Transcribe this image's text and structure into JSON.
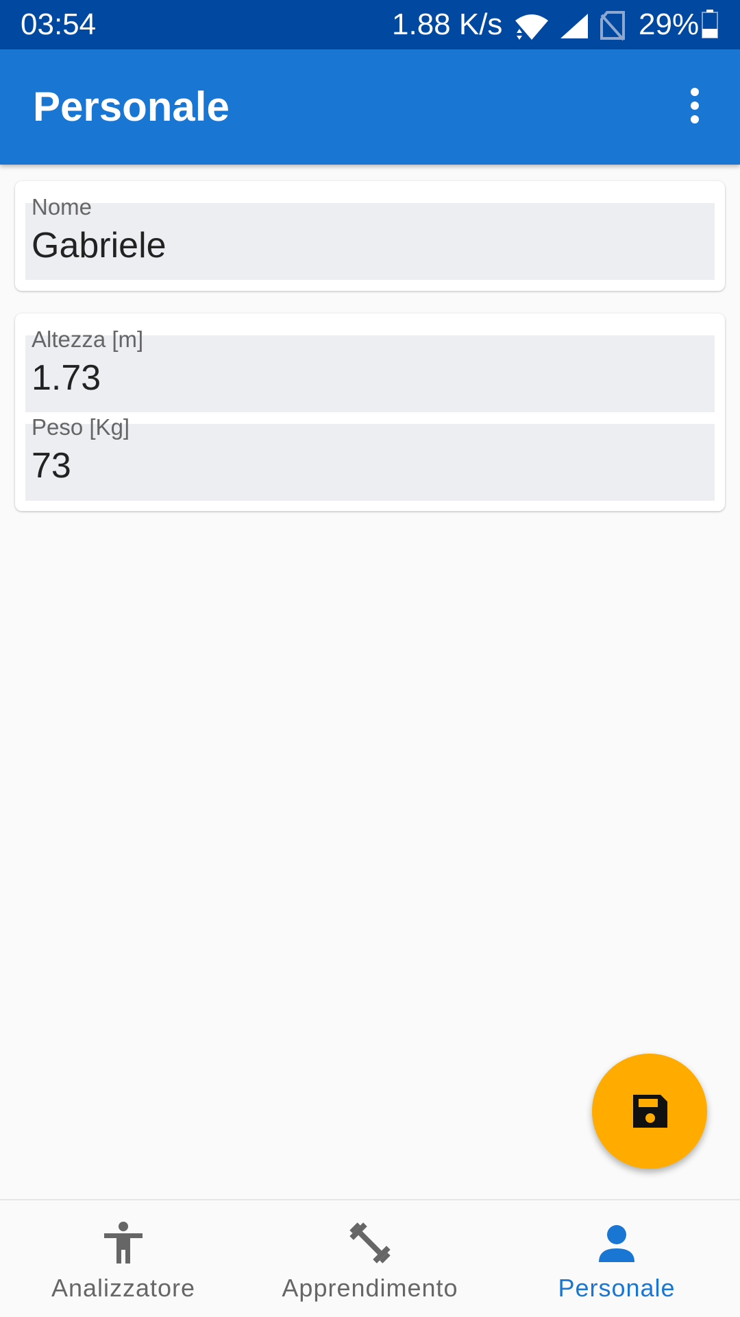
{
  "status_bar": {
    "time": "03:54",
    "network_speed": "1.88 K/s",
    "battery_percent": "29%",
    "icons": [
      "wifi-icon",
      "cell-signal-icon",
      "no-sim-icon",
      "battery-icon"
    ]
  },
  "app_bar": {
    "title": "Personale",
    "overflow_icon": "more-vert-icon"
  },
  "form": {
    "name": {
      "label": "Nome",
      "value": "Gabriele"
    },
    "height": {
      "label": "Altezza [m]",
      "value": "1.73"
    },
    "weight": {
      "label": "Peso [Kg]",
      "value": "73"
    }
  },
  "fab": {
    "icon": "save-icon"
  },
  "bottom_nav": {
    "items": [
      {
        "label": "Analizzatore",
        "icon": "accessibility-icon",
        "active": false
      },
      {
        "label": "Apprendimento",
        "icon": "fitness-dumbbell-icon",
        "active": false
      },
      {
        "label": "Personale",
        "icon": "person-icon",
        "active": true
      }
    ]
  },
  "colors": {
    "status_bar": "#0048A0",
    "primary": "#1976D2",
    "accent": "#FFAB00",
    "field_background": "#ECEEF1",
    "inactive_nav": "#666666"
  }
}
